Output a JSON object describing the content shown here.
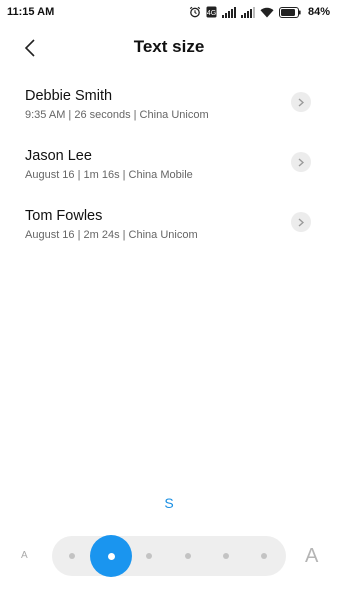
{
  "status_bar": {
    "time": "11:15 AM",
    "battery_percent": "84%",
    "icons": [
      "alarm-icon",
      "sim-icon",
      "signal-icon",
      "signal-icon",
      "wifi-icon",
      "battery-icon"
    ]
  },
  "header": {
    "title": "Text size",
    "back_icon": "chevron-left-icon"
  },
  "calls": [
    {
      "name": "Debbie Smith",
      "detail": "9:35 AM | 26 seconds | China Unicom"
    },
    {
      "name": "Jason Lee",
      "detail": "August 16 | 1m 16s | China Mobile"
    },
    {
      "name": "Tom Fowles",
      "detail": "August 16 | 2m 24s | China Unicom"
    }
  ],
  "text_size": {
    "current_label": "S",
    "min_label": "A",
    "max_label": "A",
    "levels": 6,
    "selected_index": 1
  },
  "colors": {
    "accent": "#1a95ef",
    "track": "#eeeeee",
    "chevron_bg": "#ececec"
  }
}
